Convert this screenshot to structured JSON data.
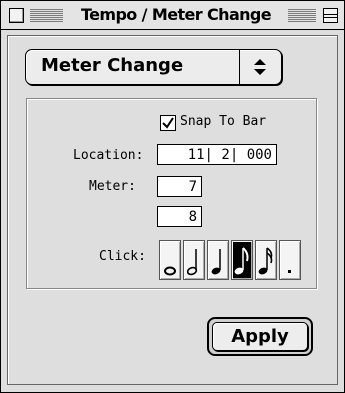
{
  "window": {
    "title": "Tempo / Meter Change"
  },
  "popup": {
    "selected": "Meter Change",
    "arrows": "↕"
  },
  "snap": {
    "label": "Snap To Bar",
    "checked": true,
    "mark": "✓"
  },
  "location": {
    "label": "Location:",
    "value": "11| 2| 000"
  },
  "meter": {
    "label": "Meter:",
    "numerator": "7",
    "denominator": "8"
  },
  "click": {
    "label": "Click:",
    "options": [
      {
        "icon": "whole-note-icon",
        "selected": false
      },
      {
        "icon": "half-note-icon",
        "selected": false
      },
      {
        "icon": "quarter-note-icon",
        "selected": false
      },
      {
        "icon": "eighth-note-icon",
        "selected": true
      },
      {
        "icon": "sixteenth-note-icon",
        "selected": false
      },
      {
        "icon": "dot-icon",
        "selected": false
      }
    ]
  },
  "buttons": {
    "apply": "Apply"
  }
}
